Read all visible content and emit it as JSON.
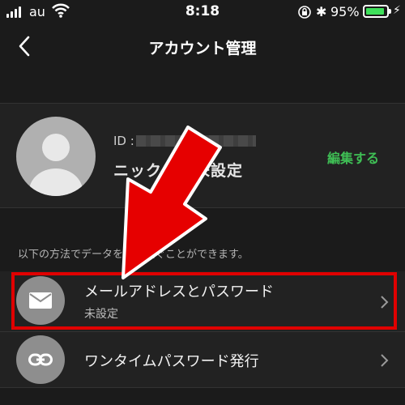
{
  "status_bar": {
    "carrier": "au",
    "time": "8:18",
    "battery_percent": "95%",
    "battery_level": 0.95,
    "icons": [
      "signal-icon",
      "wifi-icon",
      "rotation-lock-icon",
      "bluetooth-icon",
      "battery-icon",
      "charging-icon"
    ]
  },
  "nav": {
    "title": "アカウント管理",
    "back_icon": "chevron-left-icon"
  },
  "profile": {
    "id_label": "ID :",
    "nickname": "ニックネ　未設定",
    "edit_label": "編集する",
    "edit_color": "#3fbf55"
  },
  "info_text": "以下の方法でデータを引き継ぐことができます。",
  "methods": [
    {
      "title": "メールアドレスとパスワード",
      "subtitle": "未設定",
      "icon": "mail-icon"
    },
    {
      "title": "ワンタイムパスワード発行",
      "subtitle": "",
      "icon": "link-icon"
    }
  ],
  "annotation": {
    "highlight_color": "#e00000",
    "arrow_color": "#e00000"
  }
}
